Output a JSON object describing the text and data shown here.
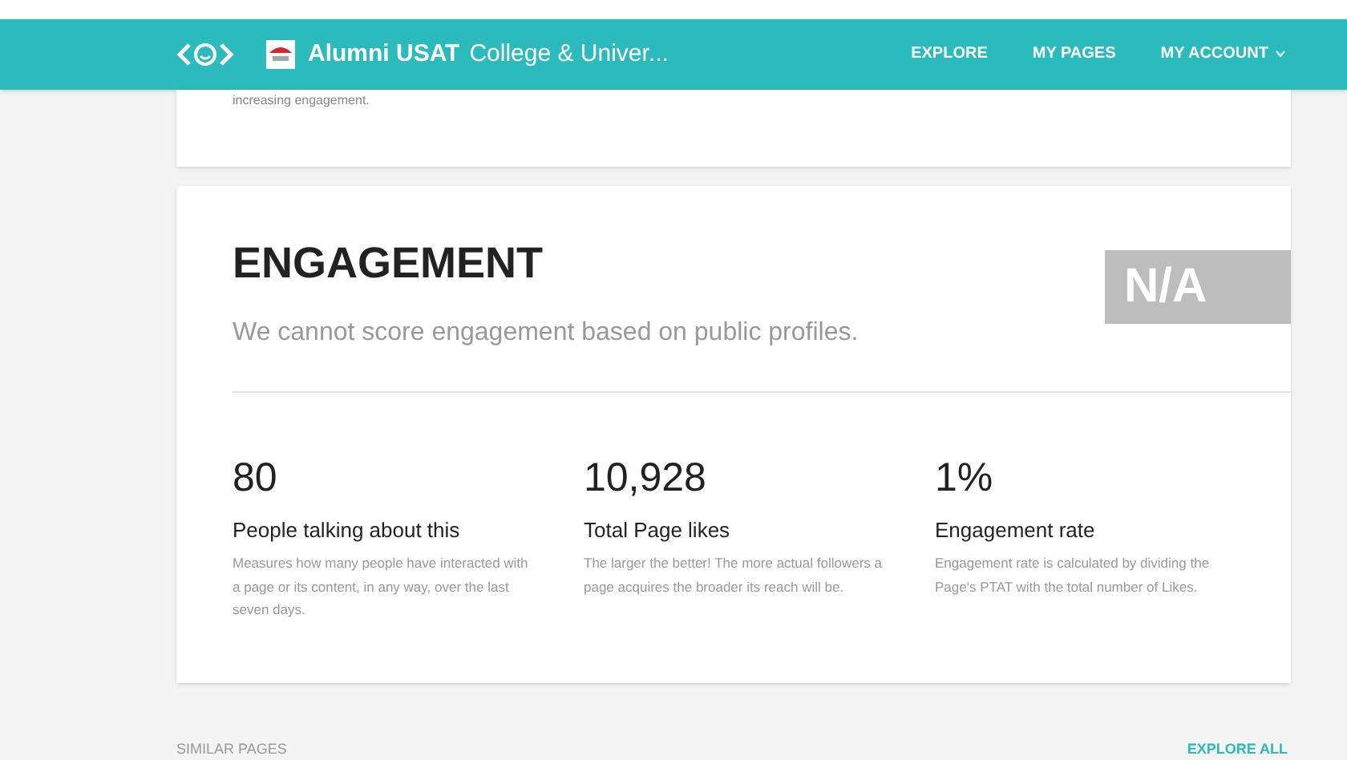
{
  "header": {
    "title": "Alumni USAT",
    "category": "College & Univer...",
    "nav": [
      {
        "label": "EXPLORE",
        "dropdown": false
      },
      {
        "label": "MY PAGES",
        "dropdown": false
      },
      {
        "label": "MY ACCOUNT",
        "dropdown": true
      }
    ]
  },
  "previous_card": {
    "text": "increasing engagement."
  },
  "engagement": {
    "title": "ENGAGEMENT",
    "subtitle": "We cannot score engagement based on public profiles.",
    "score": "N/A",
    "stats": [
      {
        "value": "80",
        "label": "People talking about this",
        "description": "Measures how many people have interacted with a page or its content, in any way, over the last seven days."
      },
      {
        "value": "10,928",
        "label": "Total Page likes",
        "description": "The larger the better! The more actual followers a page acquires the broader its reach will be."
      },
      {
        "value": "1%",
        "label": "Engagement rate",
        "description": "Engagement rate is calculated by dividing the Page's PTAT with the total number of Likes."
      }
    ]
  },
  "similar_pages": {
    "heading": "SIMILAR PAGES",
    "link": "EXPLORE ALL"
  }
}
